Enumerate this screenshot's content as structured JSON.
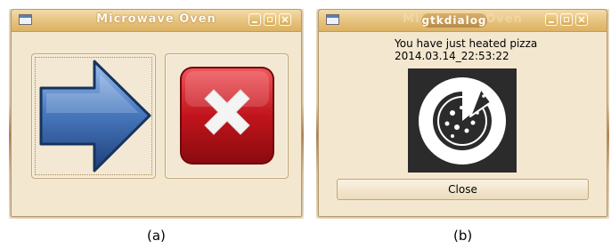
{
  "left_window": {
    "title": "Microwave Oven",
    "icons": {
      "app": "window-app-icon",
      "minimize": "minimize-icon",
      "maximize": "maximize-icon",
      "close": "close-icon"
    },
    "arrow_button_icon": "blue-right-arrow-icon",
    "cancel_button_icon": "red-x-icon",
    "arrow_color": "#3a68aa",
    "cancel_color": "#c0131b"
  },
  "right_window": {
    "background_title": "Microwave Oven",
    "title": "gtkdialog",
    "message_line1": "You have just heated pizza",
    "message_line2": "2014.03.14_22:53:22",
    "image_icon": "pizza-icon",
    "close_label": "Close"
  },
  "captions": {
    "a": "(a)",
    "b": "(b)"
  }
}
